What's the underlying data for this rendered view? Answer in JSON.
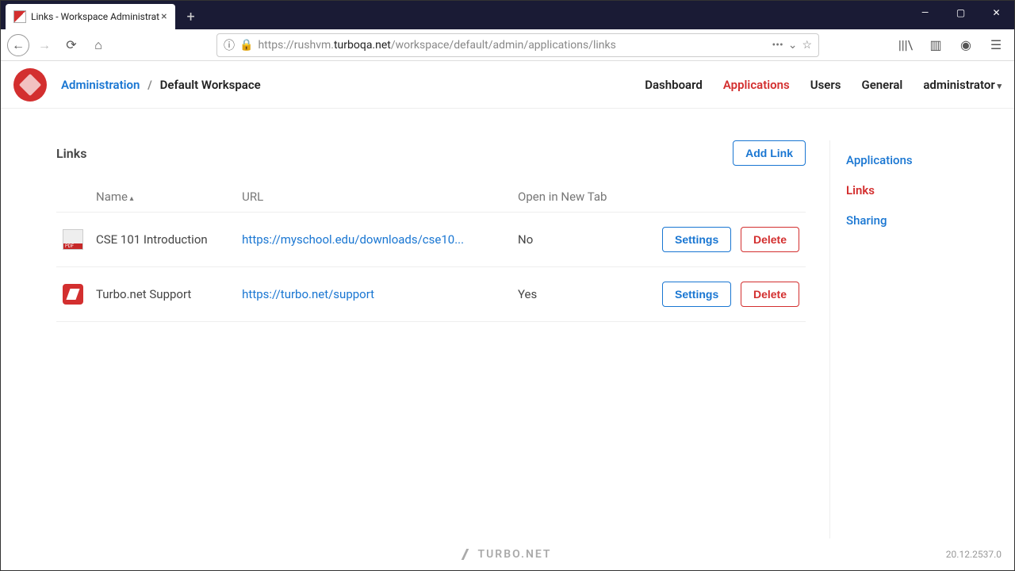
{
  "window": {
    "tab_title": "Links - Workspace Administrat"
  },
  "browser": {
    "url_pre": "https://rushvm.",
    "url_host": "turboqa.net",
    "url_path": "/workspace/default/admin/applications/links"
  },
  "breadcrumb": {
    "root": "Administration",
    "sep": "/",
    "current": "Default Workspace"
  },
  "top_nav": {
    "dashboard": "Dashboard",
    "applications": "Applications",
    "users": "Users",
    "general": "General",
    "user": "administrator"
  },
  "page": {
    "title": "Links",
    "add_link": "Add Link",
    "col_name": "Name",
    "col_url": "URL",
    "col_open": "Open in New Tab",
    "settings_btn": "Settings",
    "delete_btn": "Delete"
  },
  "rows": [
    {
      "name": "CSE 101 Introduction",
      "url": "https://myschool.edu/downloads/cse10...",
      "open": "No"
    },
    {
      "name": "Turbo.net Support",
      "url": "https://turbo.net/support",
      "open": "Yes"
    }
  ],
  "side_nav": {
    "applications": "Applications",
    "links": "Links",
    "sharing": "Sharing"
  },
  "footer": {
    "brand": "TURBO.NET",
    "version": "20.12.2537.0"
  }
}
